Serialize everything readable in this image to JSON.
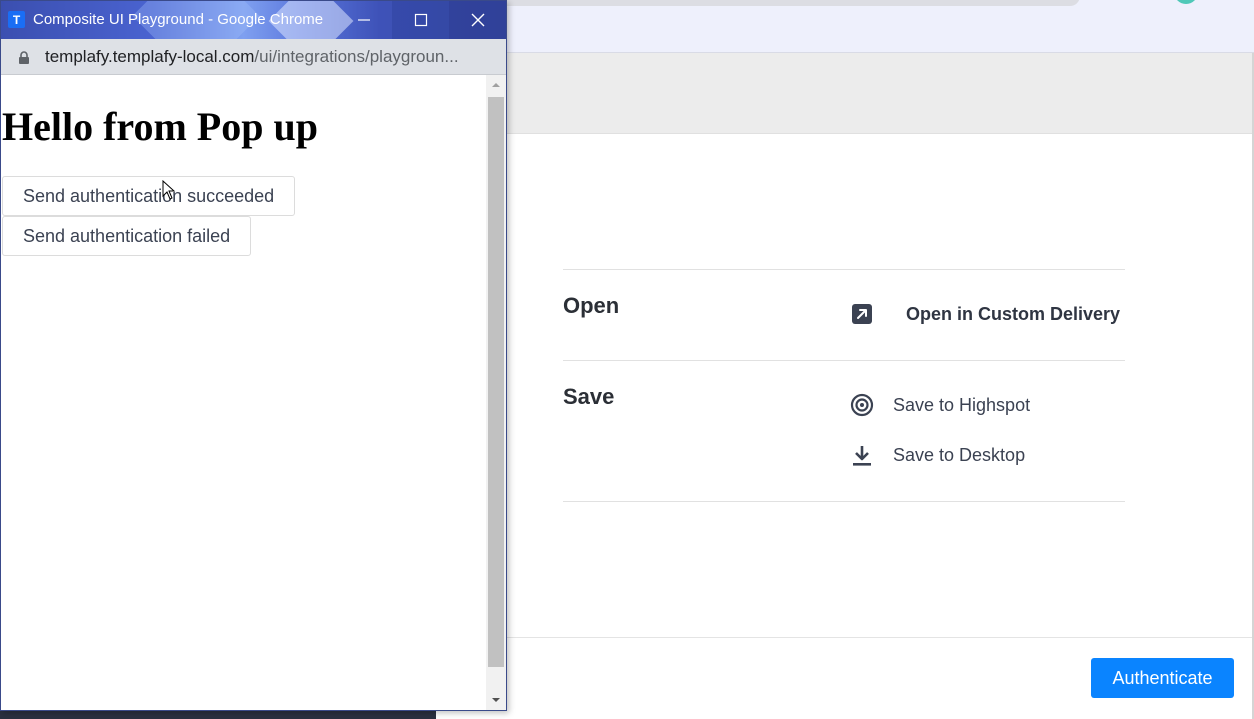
{
  "popup": {
    "window_title": "Composite UI Playground - Google Chrome",
    "app_icon_letter": "T",
    "url_host": "templafy.templafy-local.com",
    "url_path": "/ui/integrations/playgroun...",
    "heading": "Hello from Pop up",
    "buttons": {
      "succeeded": "Send authentication succeeded",
      "failed": "Send authentication failed"
    }
  },
  "main": {
    "open_section": {
      "title": "Open",
      "action_label": "Open in Custom Delivery",
      "icon": "external-link-icon"
    },
    "save_section": {
      "title": "Save",
      "actions": [
        {
          "label": "Save to Highspot",
          "icon": "highspot-icon"
        },
        {
          "label": "Save to Desktop",
          "icon": "download-icon"
        }
      ]
    }
  },
  "footer": {
    "authenticate_label": "Authenticate"
  },
  "colors": {
    "accent": "#0a84ff",
    "text": "#2b2f36",
    "titlebar": "#3b4fb0"
  }
}
